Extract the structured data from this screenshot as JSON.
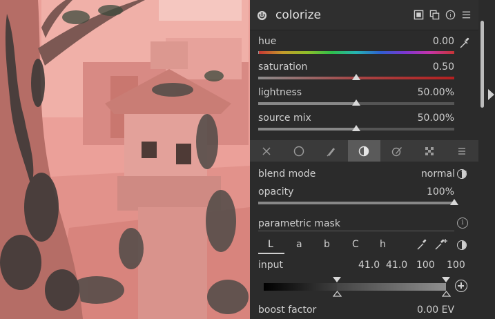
{
  "module": {
    "title": "colorize",
    "header_icons": [
      "power-icon",
      "presets-icon",
      "multi-instance-icon",
      "reset-icon",
      "menu-icon"
    ]
  },
  "sliders": [
    {
      "label": "hue",
      "value": "0.00",
      "level": 0.0
    },
    {
      "label": "saturation",
      "value": "0.50",
      "level": 0.5
    },
    {
      "label": "lightness",
      "value": "50.00%",
      "level": 0.5
    },
    {
      "label": "source mix",
      "value": "50.00%",
      "level": 0.5
    }
  ],
  "blend_tabs": [
    "off-icon",
    "uniformly-icon",
    "drawn-mask-icon",
    "parametric-mask-icon",
    "drawn-parametric-icon",
    "raster-mask-icon",
    "menu-icon"
  ],
  "active_blend_tab": 3,
  "blend": {
    "mode_label": "blend mode",
    "mode_value": "normal",
    "opacity_label": "opacity",
    "opacity_value": "100%",
    "opacity_level": 1.0
  },
  "mask": {
    "title": "parametric mask",
    "channels": [
      "L",
      "a",
      "b",
      "C",
      "h"
    ],
    "active_channel": "L",
    "input_label": "input",
    "input_values": [
      "41.0",
      "41.0",
      "100",
      "100"
    ],
    "boost_label": "boost factor",
    "boost_value": "0.00 EV"
  },
  "colors": {
    "panel_bg": "#2b2b2b",
    "preview_tint": "#e99a93",
    "accent_text": "#cfcfcf"
  }
}
